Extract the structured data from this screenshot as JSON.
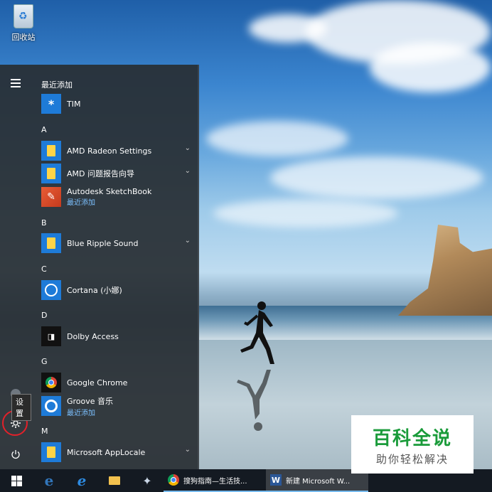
{
  "desktop": {
    "recycle_bin_label": "回收站"
  },
  "start_menu": {
    "recent_header": "最近添加",
    "tooltip": "设置",
    "sections": {
      "a": "A",
      "b": "B",
      "c": "C",
      "d": "D",
      "g": "G",
      "m": "M"
    },
    "items": [
      {
        "label": "TIM",
        "sub": ""
      },
      {
        "label": "AMD Radeon Settings",
        "sub": ""
      },
      {
        "label": "AMD 问题报告向导",
        "sub": ""
      },
      {
        "label": "Autodesk SketchBook",
        "sub": "最近添加"
      },
      {
        "label": "Blue Ripple Sound",
        "sub": ""
      },
      {
        "label": "Cortana (小娜)",
        "sub": ""
      },
      {
        "label": "Dolby Access",
        "sub": ""
      },
      {
        "label": "Google Chrome",
        "sub": ""
      },
      {
        "label": "Groove 音乐",
        "sub": "最近添加"
      },
      {
        "label": "Microsoft AppLocale",
        "sub": ""
      }
    ]
  },
  "taskbar": {
    "apps": [
      {
        "label": "搜狗指南—生活技...",
        "icon": "chrome-icon"
      },
      {
        "label": "新建 Microsoft W...",
        "icon": "word-icon"
      }
    ]
  },
  "watermark": {
    "title": "百科全说",
    "subtitle": "助你轻松解决"
  },
  "colors": {
    "accent": "#1e7bd8",
    "highlight_ring": "#e2212a",
    "watermark_green": "#1a9b3a"
  }
}
